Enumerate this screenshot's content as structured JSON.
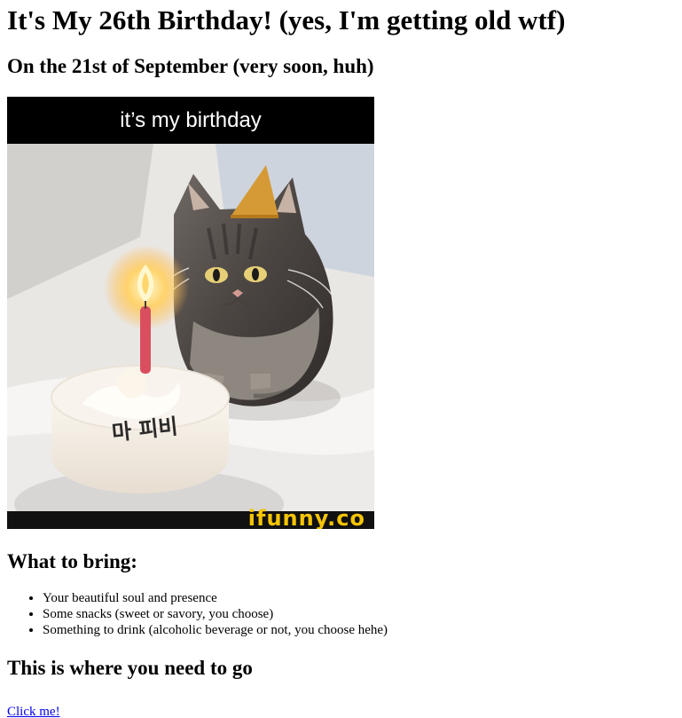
{
  "header": {
    "title": "It's My 26th Birthday! (yes, I'm getting old wtf)",
    "subtitle": "On the 21st of September (very soon, huh)"
  },
  "meme": {
    "caption": "it’s my birthday",
    "cake_text": "마 피비",
    "watermark": "ifunny.co"
  },
  "bring": {
    "heading": "What to bring:",
    "items": [
      "Your beautiful soul and presence",
      "Some snacks (sweet or savory, you choose)",
      "Something to drink (alcoholic beverage or not, you choose hehe)"
    ]
  },
  "location": {
    "heading": "This is where you need to go",
    "link_label": "Click me!"
  },
  "colors": {
    "link": "#0000ee",
    "meme_bar": "#000000",
    "watermark": "#f5c400"
  }
}
